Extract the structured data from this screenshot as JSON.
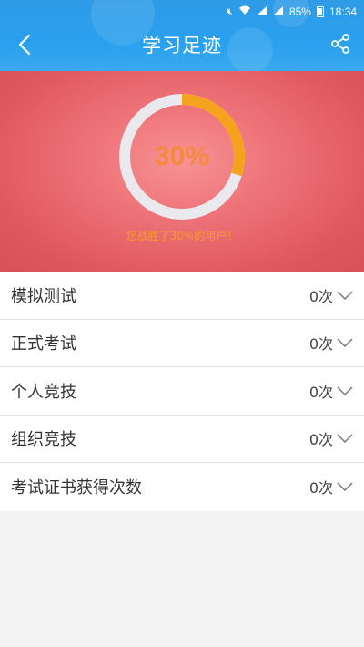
{
  "status_bar": {
    "battery": "85%",
    "time": "18:34",
    "icons": [
      "mute-icon",
      "wifi-icon",
      "signal-3g-icon",
      "signal-4g-icon",
      "battery-icon"
    ]
  },
  "header": {
    "title": "学习足迹",
    "back_icon": "chevron-left-icon",
    "share_icon": "share-icon"
  },
  "progress": {
    "percent_text": "30%",
    "value": 0.3,
    "beat_text": "您战胜了30%的用户！",
    "ring_color": "#f5a21c",
    "track_color": "#e9e9ee"
  },
  "items": [
    {
      "label": "模拟测试",
      "count": "0次"
    },
    {
      "label": "正式考试",
      "count": "0次"
    },
    {
      "label": "个人竞技",
      "count": "0次"
    },
    {
      "label": "组织竞技",
      "count": "0次"
    },
    {
      "label": "考试证书获得次数",
      "count": "0次"
    }
  ]
}
